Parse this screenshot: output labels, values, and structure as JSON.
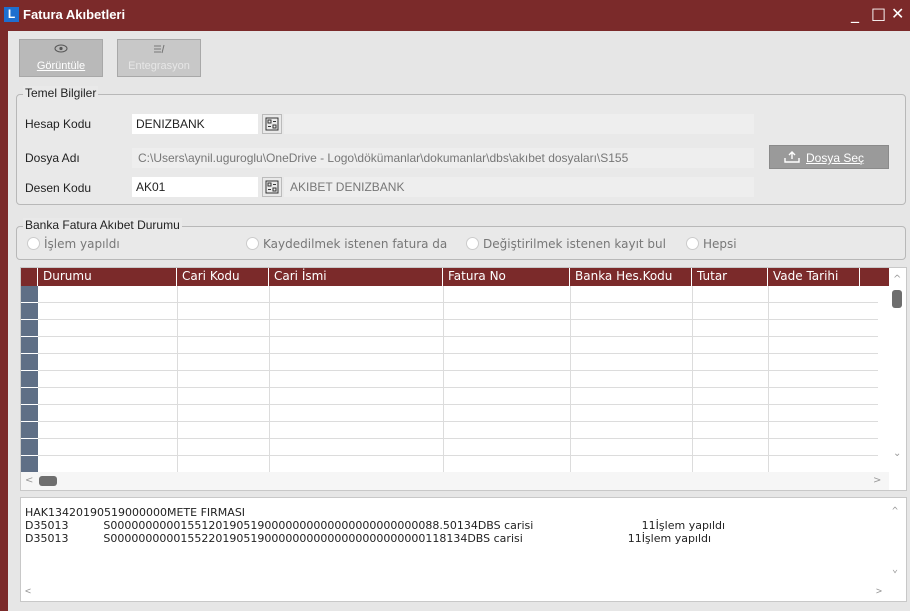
{
  "window": {
    "title": "Fatura Akıbetleri",
    "logo": "L",
    "minimize": "_",
    "maximize": "□",
    "close": "✕"
  },
  "toolbar": {
    "view_label": "Görüntüle",
    "view_icon": "eye-icon",
    "integration_label": "Entegrasyon",
    "integration_icon": "list-icon"
  },
  "basic_info": {
    "title": "Temel Bilgiler",
    "account_code_label": "Hesap Kodu",
    "account_code_value": "DENIZBANK",
    "account_desc": "",
    "file_name_label": "Dosya Adı",
    "file_name_value": "C:\\Users\\aynil.uguroglu\\OneDrive - Logo\\dökümanlar\\dokumanlar\\dbs\\akıbet dosyaları\\S155",
    "select_file_button": "Dosya Seç",
    "pattern_code_label": "Desen Kodu",
    "pattern_code_value": "AK01",
    "pattern_desc": "AKIBET DENIZBANK"
  },
  "status_group": {
    "title": "Banka Fatura Akıbet Durumu",
    "options": [
      "İşlem yapıldı",
      "Kaydedilmek istenen fatura da",
      "Değiştirilmek istenen kayıt bul",
      "Hepsi"
    ]
  },
  "grid": {
    "columns": [
      "Durumu",
      "Cari Kodu",
      "Cari İsmi",
      "Fatura No",
      "Banka Hes.Kodu",
      "Tutar",
      "Vade Tarihi"
    ]
  },
  "log": {
    "lines": [
      "HAK13420190519000000METE FIRMASI",
      "D35013          S00000000001551201905190000000000000000000000088.50134DBS carisi                               11İşlem yapıldı",
      "D35013          S000000000015522019051900000000000000000000000118134DBS carisi                              11İşlem yapıldı"
    ]
  }
}
